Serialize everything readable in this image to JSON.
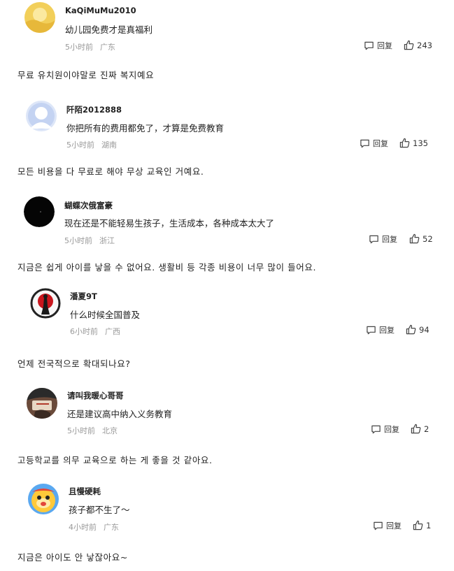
{
  "comments": [
    {
      "username": "KaQiMuMu2010",
      "text": "幼儿园免费才是真福利",
      "time": "5小时前",
      "location": "广东",
      "reply_label": "回复",
      "likes": "243",
      "avatar_icon": "sun-landscape-avatar-icon"
    },
    {
      "username": "阡陌2012888",
      "text": "你把所有的费用都免了，才算是免费教育",
      "time": "5小时前",
      "location": "湖南",
      "reply_label": "回复",
      "likes": "135",
      "avatar_icon": "default-user-avatar-icon"
    },
    {
      "username": "蝴蝶次俄富豪",
      "text": "现在还是不能轻易生孩子，生活成本，各种成本太大了",
      "time": "5小时前",
      "location": "浙江",
      "reply_label": "回复",
      "likes": "52",
      "avatar_icon": "black-circle-avatar-icon"
    },
    {
      "username": "潘夏9T",
      "text": "什么时候全国普及",
      "time": "6小时前",
      "location": "广西",
      "reply_label": "回复",
      "likes": "94",
      "avatar_icon": "red-sun-warrior-avatar-icon"
    },
    {
      "username": "请叫我暖心哥哥",
      "text": "还是建议高中纳入义务教育",
      "time": "5小时前",
      "location": "北京",
      "reply_label": "回复",
      "likes": "2",
      "avatar_icon": "photo-avatar-icon"
    },
    {
      "username": "且慢硬耗",
      "text": "孩子都不生了～",
      "time": "4小时前",
      "location": "广东",
      "reply_label": "回复",
      "likes": "1",
      "avatar_icon": "yellow-cartoon-avatar-icon"
    }
  ],
  "translations": [
    "무료 유치원이야말로 진짜 복지예요",
    "모든 비용을 다 무료로 해야 무상 교육인 거예요.",
    "지금은 쉽게 아이를 낳을 수 없어요. 생활비 등 각종 비용이 너무 많이 들어요.",
    "언제 전국적으로 확대되나요?",
    "고등학교를 의무 교육으로 하는 게 좋을 것 같아요.",
    "지금은 아이도 안 낳잖아요~"
  ]
}
